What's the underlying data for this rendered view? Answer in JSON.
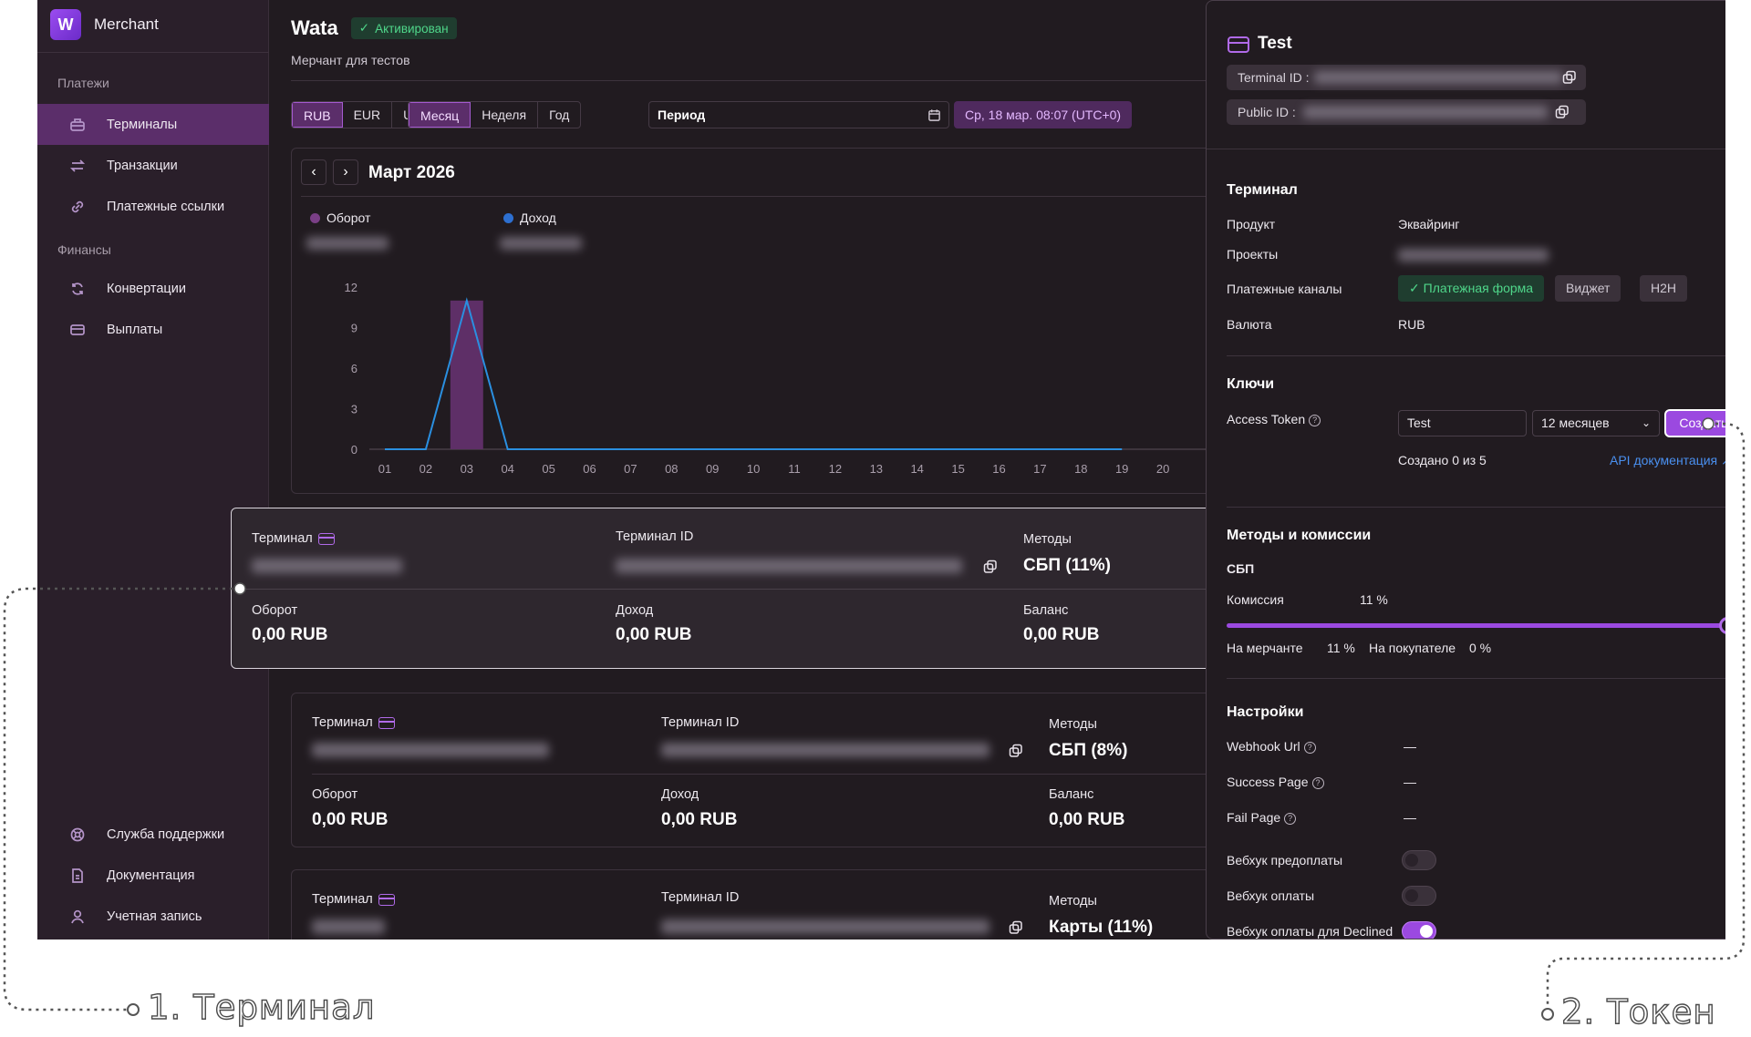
{
  "sidebar": {
    "brand": "Merchant",
    "section_payments": "Платежи",
    "section_finance": "Финансы",
    "items": [
      {
        "label": "Терминалы",
        "icon": "terminal-icon"
      },
      {
        "label": "Транзакции",
        "icon": "arrows-icon"
      },
      {
        "label": "Платежные ссылки",
        "icon": "link-icon"
      },
      {
        "label": "Конвертации",
        "icon": "refresh-icon"
      },
      {
        "label": "Выплаты",
        "icon": "card-icon"
      }
    ],
    "bottom": [
      {
        "label": "Служба поддержки",
        "icon": "lifebuoy-icon"
      },
      {
        "label": "Документация",
        "icon": "document-icon"
      },
      {
        "label": "Учетная запись",
        "icon": "user-icon"
      }
    ]
  },
  "header": {
    "title": "Wata",
    "status": "Активирован",
    "subtitle": "Мерчант для тестов"
  },
  "filters": {
    "currencies": [
      "RUB",
      "EUR",
      "USD"
    ],
    "currency_selected": "RUB",
    "ranges": [
      "Месяц",
      "Неделя",
      "Год"
    ],
    "range_selected": "Месяц",
    "period_label": "Период",
    "date_chip": "Ср, 18 мар. 08:07 (UTC+0)"
  },
  "chart": {
    "month": "Март 2026",
    "legend": [
      {
        "name": "Оборот",
        "color": "#7a3f86"
      },
      {
        "name": "Доход",
        "color": "#2d6fd0"
      }
    ]
  },
  "chart_data": {
    "type": "bar",
    "categories": [
      "01",
      "02",
      "03",
      "04",
      "05",
      "06",
      "07",
      "08",
      "09",
      "10",
      "11",
      "12",
      "13",
      "14",
      "15",
      "16",
      "17",
      "18",
      "19",
      "20"
    ],
    "series": [
      {
        "name": "Оборот",
        "type": "bar",
        "values": [
          0,
          0,
          11,
          0,
          0,
          0,
          0,
          0,
          0,
          0,
          0,
          0,
          0,
          0,
          0,
          0,
          0,
          0,
          0,
          0
        ]
      },
      {
        "name": "Доход",
        "type": "line",
        "values": [
          0,
          0,
          11,
          0,
          0,
          0,
          0,
          0,
          0,
          0,
          0,
          0,
          0,
          0,
          0,
          0,
          0,
          0,
          0
        ]
      }
    ],
    "yticks": [
      0,
      3,
      6,
      9,
      12
    ],
    "ylim": [
      0,
      12
    ],
    "grid": false
  },
  "terminals": [
    {
      "label": "Терминал",
      "id_label": "Терминал ID",
      "methods_label": "Методы",
      "methods": "СБП (11%)",
      "turnover_label": "Оборот",
      "turnover": "0,00 RUB",
      "income_label": "Доход",
      "income": "0,00 RUB",
      "balance_label": "Баланс",
      "balance": "0,00 RUB"
    },
    {
      "label": "Терминал",
      "id_label": "Терминал ID",
      "methods_label": "Методы",
      "methods": "СБП (8%)",
      "turnover_label": "Оборот",
      "turnover": "0,00 RUB",
      "income_label": "Доход",
      "income": "0,00 RUB",
      "balance_label": "Баланс",
      "balance": "0,00 RUB"
    },
    {
      "label": "Терминал",
      "id_label": "Терминал ID",
      "methods_label": "Методы",
      "methods": "Карты (11%)"
    }
  ],
  "panel": {
    "title": "Test",
    "terminal_id_label": "Terminal ID :",
    "public_id_label": "Public ID :",
    "terminal_section": "Терминал",
    "product_label": "Продукт",
    "product": "Эквайринг",
    "projects_label": "Проекты",
    "channels_label": "Платежные каналы",
    "channels": [
      "Платежная форма",
      "Виджет",
      "H2H"
    ],
    "currency_label": "Валюта",
    "currency": "RUB",
    "keys_section": "Ключи",
    "access_token_label": "Access Token",
    "token_name_value": "Test",
    "token_period": "12 месяцев",
    "create_button": "Создать",
    "created_text": "Создано 0 из 5",
    "api_docs_link": "API документация",
    "methods_section": "Методы и комиссии",
    "method_name": "СБП",
    "commission_label": "Комиссия",
    "commission_value": "11 %",
    "commission_level": 1.0,
    "merchant_label": "На мерчанте",
    "merchant_value": "11 %",
    "buyer_label": "На покупателе",
    "buyer_value": "0 %",
    "settings_section": "Настройки",
    "settings": [
      {
        "label": "Webhook Url",
        "value": "—"
      },
      {
        "label": "Success Page",
        "value": "—"
      },
      {
        "label": "Fail Page",
        "value": "—"
      }
    ],
    "toggles": [
      {
        "label": "Вебхук предоплаты",
        "on": false
      },
      {
        "label": "Вебхук оплаты",
        "on": false
      },
      {
        "label": "Вебхук оплаты для Declined",
        "on": true
      }
    ]
  },
  "annotations": {
    "step1": "1. Терминал",
    "step2": "2. Токен"
  }
}
